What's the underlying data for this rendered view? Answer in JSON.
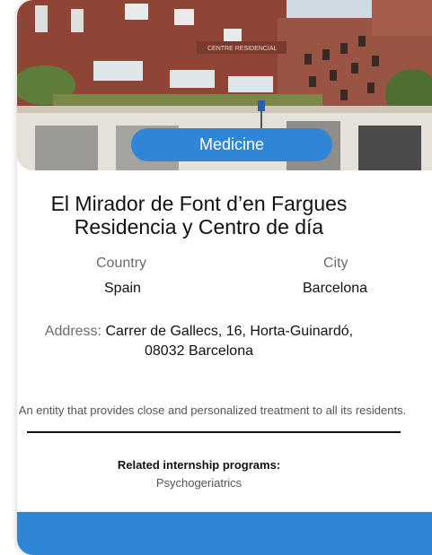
{
  "card": {
    "category_badge": "Medicine",
    "title_line1": "El Mirador de Font d’en Fargues",
    "title_line2": "Residencia y Centro de día",
    "country_label": "Country",
    "country_value": "Spain",
    "city_label": "City",
    "city_value": "Barcelona",
    "address_label": "Address:",
    "address_line1": "Carrer de Gallecs, 16, Horta-Guinardó,",
    "address_line2": "08032 Barcelona",
    "description": "An entity that provides close and personalized treatment to all its residents.",
    "related_title": "Related internship programs:",
    "related_items": [
      "Psychogeriatrics"
    ],
    "photo_sign_text": "CENTRE RESIDENCIAL",
    "accent_color": "#2f86d6"
  }
}
